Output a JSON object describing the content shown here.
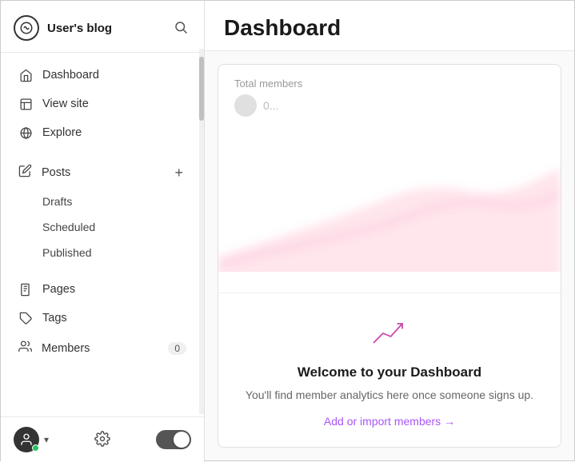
{
  "brand": {
    "name": "User's blog"
  },
  "sidebar": {
    "nav_items": [
      {
        "id": "dashboard",
        "label": "Dashboard",
        "icon": "dashboard-icon"
      },
      {
        "id": "view-site",
        "label": "View site",
        "icon": "viewsite-icon"
      },
      {
        "id": "explore",
        "label": "Explore",
        "icon": "explore-icon"
      }
    ],
    "posts_label": "Posts",
    "posts_sub": [
      {
        "id": "drafts",
        "label": "Drafts"
      },
      {
        "id": "scheduled",
        "label": "Scheduled"
      },
      {
        "id": "published",
        "label": "Published"
      }
    ],
    "pages_label": "Pages",
    "tags_label": "Tags",
    "members_label": "Members",
    "members_badge": "0"
  },
  "main": {
    "title": "Dashboard",
    "card": {
      "label": "Total members",
      "value_placeholder": "0..."
    },
    "welcome": {
      "title": "Welcome to your Dashboard",
      "description": "You'll find member analytics here once someone signs up.",
      "link": "Add or import members →"
    }
  }
}
